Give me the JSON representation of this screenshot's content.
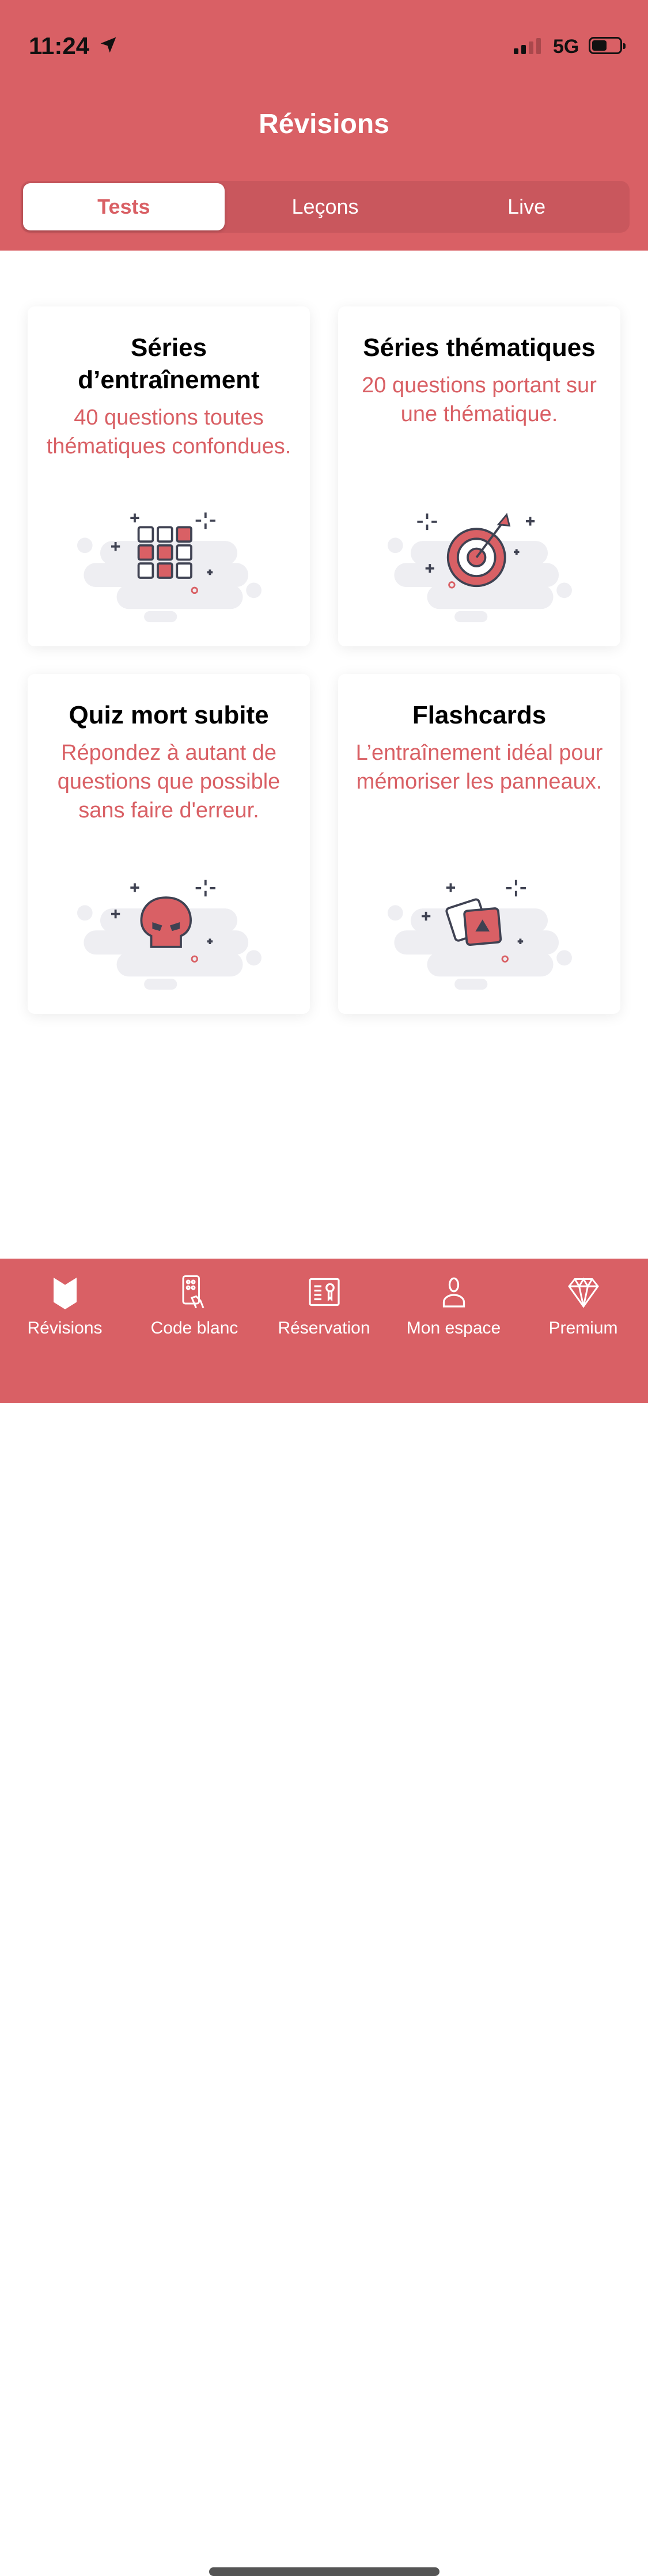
{
  "status_bar": {
    "time": "11:24",
    "network": "5G",
    "battery_level": 0.55
  },
  "header": {
    "title": "Révisions"
  },
  "tabs": [
    {
      "label": "Tests",
      "active": true
    },
    {
      "label": "Leçons",
      "active": false
    },
    {
      "label": "Live",
      "active": false
    }
  ],
  "cards": [
    {
      "title": "Séries d’entraînement",
      "description": "40 questions toutes thématiques confondues.",
      "icon": "grid-icon"
    },
    {
      "title": "Séries thématiques",
      "description": "20 questions portant sur une thématique.",
      "icon": "target-icon"
    },
    {
      "title": "Quiz mort subite",
      "description": "Répondez à autant de questions que possible sans faire d'erreur.",
      "icon": "skull-icon"
    },
    {
      "title": "Flashcards",
      "description": "L’entraînement idéal pour mémoriser les panneaux.",
      "icon": "cards-icon"
    }
  ],
  "tabbar": [
    {
      "label": "Révisions",
      "icon": "book-icon"
    },
    {
      "label": "Code blanc",
      "icon": "phone-hand-icon"
    },
    {
      "label": "Réservation",
      "icon": "certificate-icon"
    },
    {
      "label": "Mon espace",
      "icon": "user-icon"
    },
    {
      "label": "Premium",
      "icon": "diamond-icon"
    }
  ],
  "colors": {
    "brand": "#D96065",
    "dark": "#3F4252"
  }
}
